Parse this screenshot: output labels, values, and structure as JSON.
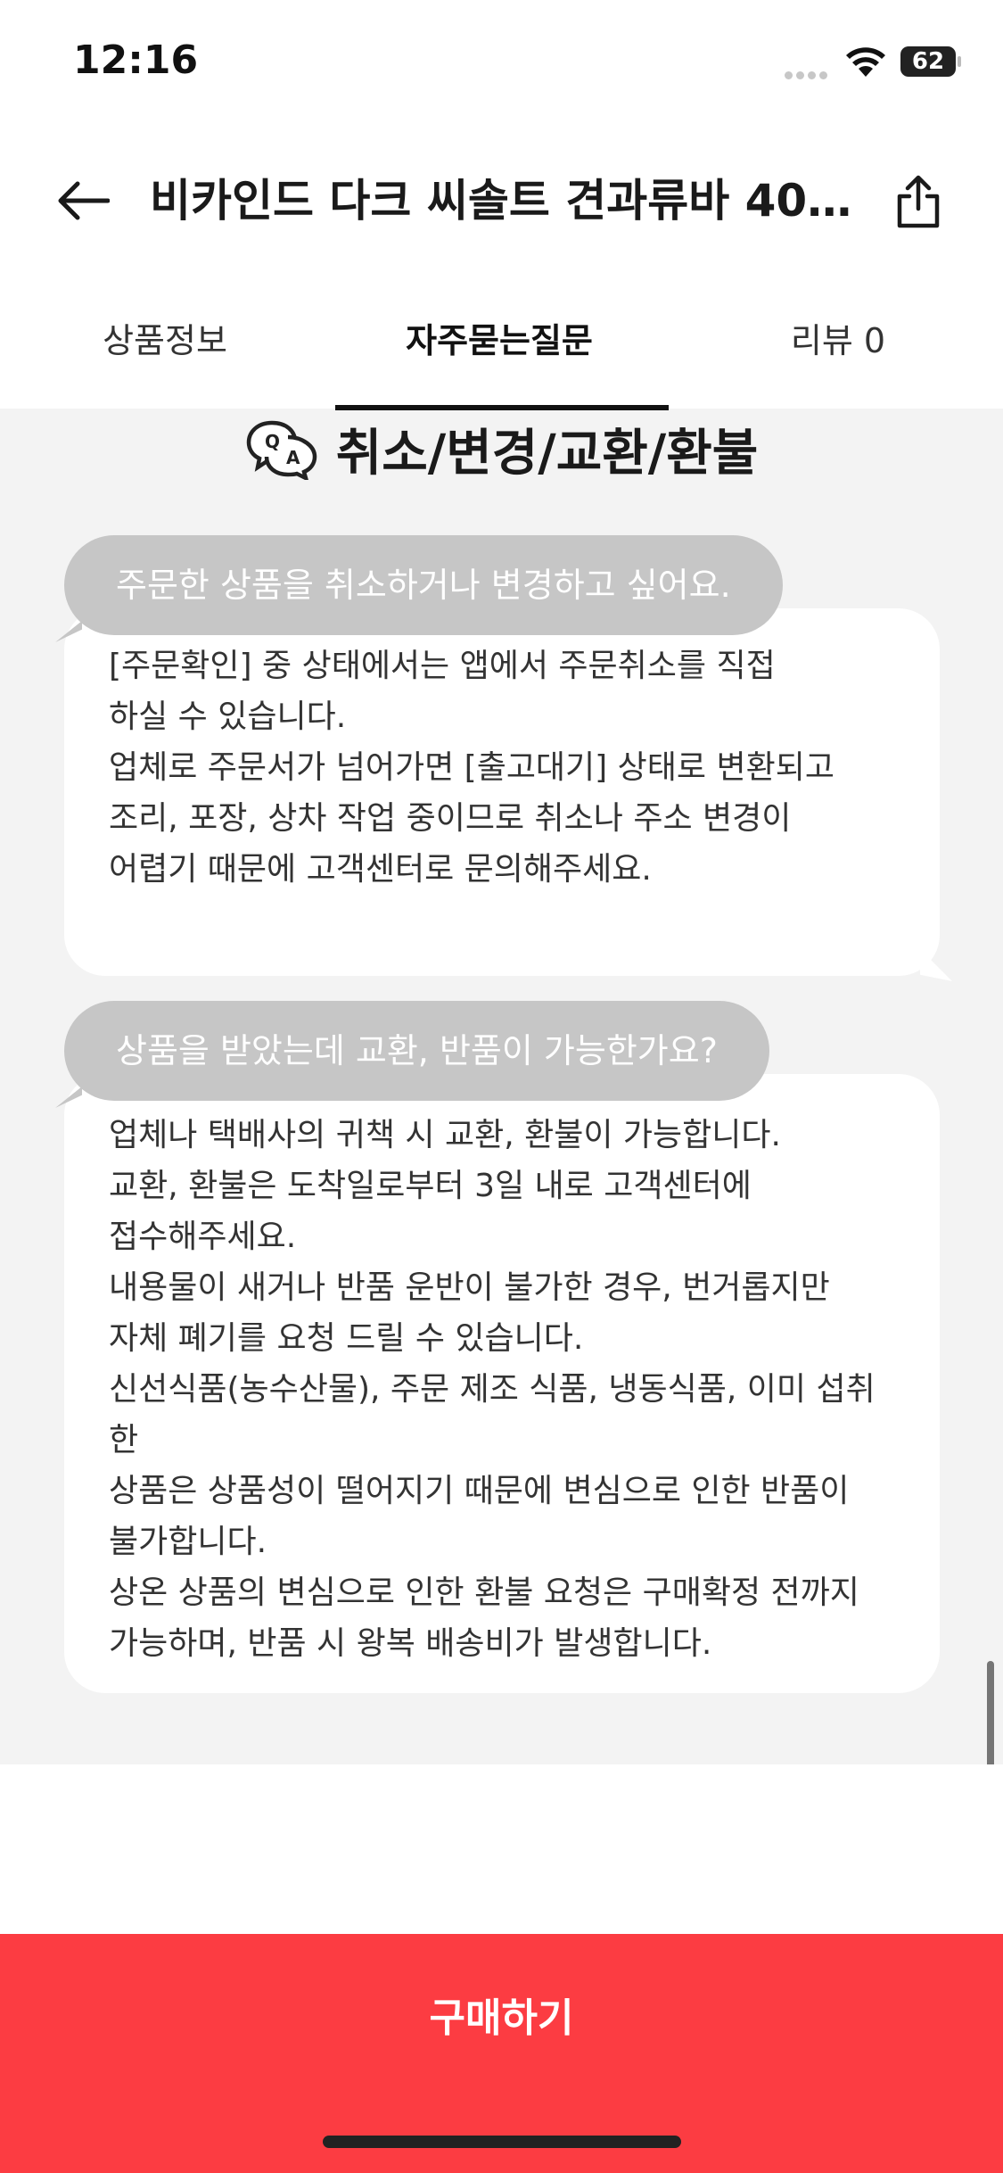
{
  "status_bar": {
    "time": "12:16",
    "battery": "62",
    "icons": [
      "signal-dots-icon",
      "wifi-icon",
      "battery-icon"
    ]
  },
  "header": {
    "title": "비카인드 다크 씨솔트 견과류바 40...",
    "back_icon": "arrow-left-icon",
    "share_icon": "share-icon"
  },
  "tabs": [
    {
      "label": "상품정보"
    },
    {
      "label": "자주묻는질문",
      "active": true
    },
    {
      "label": "리뷰 0"
    }
  ],
  "section": {
    "icon": "qa-speech-bubble-icon",
    "title": "취소/변경/교환/환불"
  },
  "faq": [
    {
      "question": "주문한 상품을 취소하거나 변경하고 싶어요.",
      "answer_lines": [
        "[주문확인] 중 상태에서는 앱에서 주문취소를 직접",
        "하실 수 있습니다.",
        "업체로 주문서가 넘어가면 [출고대기] 상태로 변환되고",
        "조리, 포장, 상차 작업 중이므로 취소나 주소 변경이",
        "어렵기 때문에 고객센터로 문의해주세요."
      ]
    },
    {
      "question": "상품을 받았는데 교환,  반품이 가능한가요?",
      "answer_lines": [
        "업체나 택배사의 귀책 시 교환, 환불이 가능합니다.",
        "교환, 환불은 도착일로부터 3일 내로 고객센터에",
        "접수해주세요.",
        "내용물이 새거나 반품 운반이 불가한 경우, 번거롭지만",
        "자체 폐기를 요청 드릴 수 있습니다.",
        "신선식품(농수산물), 주문 제조 식품, 냉동식품, 이미 섭취한",
        "상품은 상품성이 떨어지기 때문에 변심으로 인한 반품이",
        "불가합니다.",
        "상온 상품의 변심으로 인한 환불 요청은 구매확정 전까지",
        "가능하며, 반품 시 왕복 배송비가 발생합니다."
      ]
    }
  ],
  "buy_button": {
    "label": "구매하기",
    "color": "#fc3c42"
  }
}
